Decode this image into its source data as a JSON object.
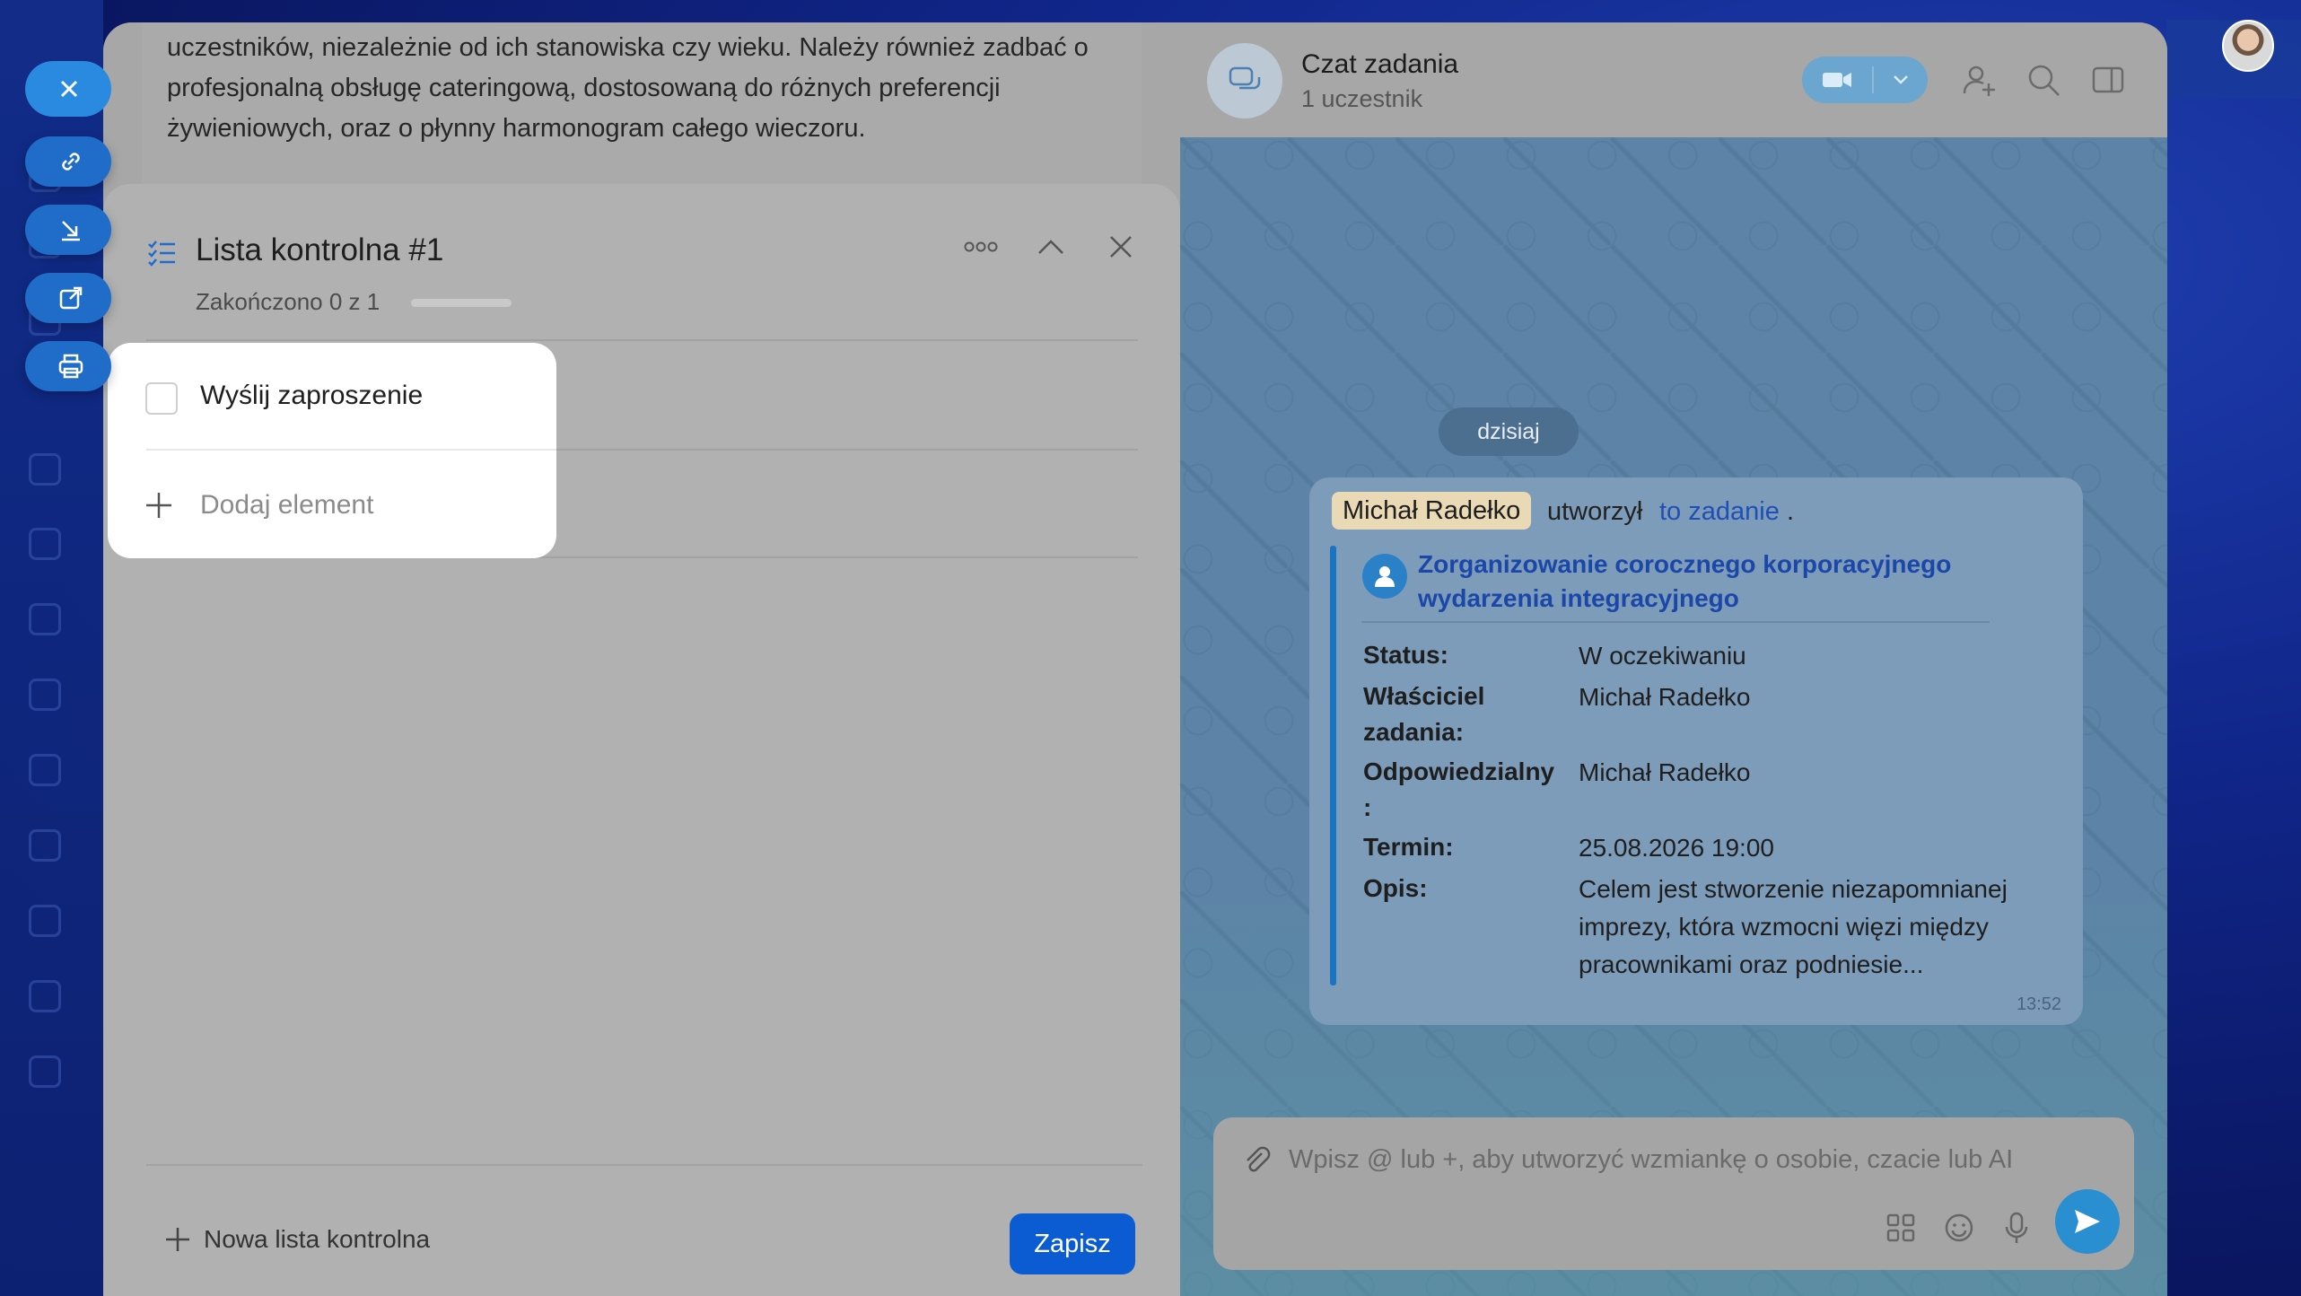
{
  "description": {
    "text": "uczestników, niezależnie od ich stanowiska czy wieku. Należy również zadbać o profesjonalną obsługę cateringową, dostosowaną do różnych preferencji żywieniowych, oraz o płynny harmonogram całego wieczoru."
  },
  "checklist": {
    "title": "Lista kontrolna #1",
    "progress_text": "Zakończono 0 z 1",
    "progress_fraction": 0,
    "items": [
      {
        "label": "Wyślij zaproszenie",
        "checked": false
      }
    ],
    "add_item_label": "Dodaj element",
    "new_list_label": "Nowa lista kontrolna",
    "save_label": "Zapisz"
  },
  "chat": {
    "title": "Czat zadania",
    "subtitle": "1 uczestnik",
    "date_label": "dzisiaj",
    "message": {
      "author": "Michał Radełko",
      "action": "utworzył",
      "link_text": "to zadanie",
      "punct": ".",
      "task_title": "Zorganizowanie corocznego korporacyjnego wydarzenia integracyjnego",
      "fields": [
        {
          "label": "Status:",
          "value": "W oczekiwaniu"
        },
        {
          "label": "Właściciel zadania:",
          "value": "Michał Radełko"
        },
        {
          "label": "Odpowiedzialny :",
          "value": "Michał Radełko"
        },
        {
          "label": "Termin:",
          "value": "25.08.2026 19:00"
        },
        {
          "label": "Opis:",
          "value": "Celem jest stworzenie niezapomnianej imprezy, która wzmocni więzi między pracownikami oraz podniesie..."
        }
      ],
      "time": "13:52"
    },
    "composer_placeholder": "Wpisz @ lub +, aby utworzyć wzmiankę o osobie, czacie lub AI"
  },
  "icons": {
    "side_buttons": [
      "close-icon",
      "link-icon",
      "download-icon",
      "open-external-icon",
      "print-icon"
    ],
    "header": [
      "video-camera-icon",
      "chevron-down-icon",
      "add-user-icon",
      "search-icon",
      "sidebar-toggle-icon"
    ]
  },
  "colors": {
    "accent_blue": "#0b5cd3",
    "link_blue": "#1f4fb5",
    "author_highlight": "#e9d9b4",
    "send_button": "#2a8fd0"
  }
}
